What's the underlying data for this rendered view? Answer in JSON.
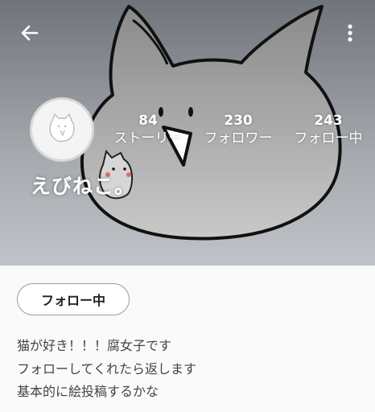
{
  "header": {
    "back_icon": "arrow-left-icon",
    "menu_icon": "more-vertical-icon"
  },
  "profile": {
    "username": "えびねこ。",
    "stats": [
      {
        "value": "84",
        "label": "ストーリー"
      },
      {
        "value": "230",
        "label": "フォロワー"
      },
      {
        "value": "243",
        "label": "フォロー中"
      }
    ],
    "follow_button_label": "フォロー中",
    "bio_lines": [
      "猫が好き！！！腐女子です",
      "フォローしてくれたら返します",
      "基本的に絵投稿するかな"
    ]
  },
  "colors": {
    "header_top": "#6f737a",
    "header_bottom": "#bfc3c8",
    "content_bg": "#fafafa",
    "text": "#444444"
  }
}
